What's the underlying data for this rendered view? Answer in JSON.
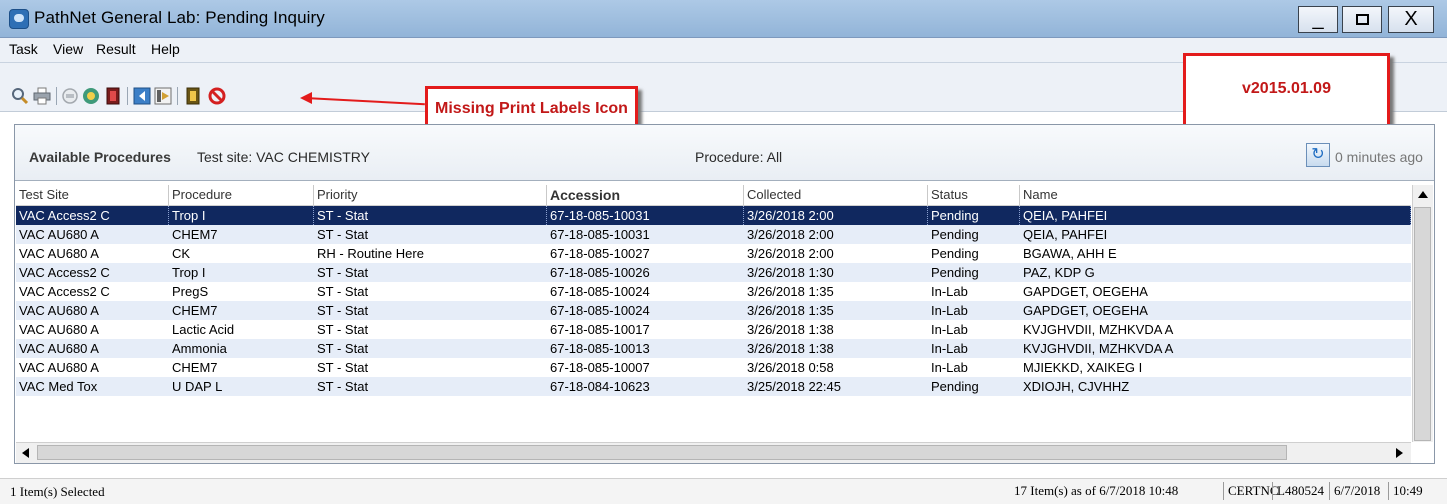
{
  "window": {
    "title": "PathNet General Lab: Pending Inquiry",
    "controls": {
      "minimize": "_",
      "close": "X"
    }
  },
  "menu": [
    "Task",
    "View",
    "Result",
    "Help"
  ],
  "toolbar": {
    "icons": [
      "magnifier-icon",
      "printer-icon",
      "disabled-icon",
      "query-icon",
      "red-book-icon",
      "blue-arrow-left-icon",
      "arrow-right-icon",
      "yellow-book-icon",
      "cancel-icon"
    ]
  },
  "annotations": {
    "missing_labels": "Missing Print Labels Icon",
    "version": "v2015.01.09"
  },
  "panel": {
    "available_label": "Available Procedures",
    "test_site": "Test site:  VAC CHEMISTRY",
    "procedure_filter": "Procedure:  All",
    "refresh_icon": "refresh-icon",
    "last_refreshed": "0 minutes ago"
  },
  "table": {
    "columns": [
      "Test Site",
      "Procedure",
      "Priority",
      "Accession",
      "Collected",
      "Status",
      "Name"
    ],
    "rows": [
      [
        "VAC Access2 C",
        "Trop I",
        "ST - Stat",
        "67-18-085-10031",
        "3/26/2018 2:00",
        "Pending",
        "QEIA, PAHFEI"
      ],
      [
        "VAC AU680 A",
        "CHEM7",
        "ST - Stat",
        "67-18-085-10031",
        "3/26/2018 2:00",
        "Pending",
        "QEIA, PAHFEI"
      ],
      [
        "VAC AU680 A",
        "CK",
        "RH - Routine Here",
        "67-18-085-10027",
        "3/26/2018 2:00",
        "Pending",
        "BGAWA, AHH E"
      ],
      [
        "VAC Access2 C",
        "Trop I",
        "ST - Stat",
        "67-18-085-10026",
        "3/26/2018 1:30",
        "Pending",
        "PAZ, KDP G"
      ],
      [
        "VAC Access2 C",
        "PregS",
        "ST - Stat",
        "67-18-085-10024",
        "3/26/2018 1:35",
        "In-Lab",
        "GAPDGET, OEGEHA"
      ],
      [
        "VAC AU680 A",
        "CHEM7",
        "ST - Stat",
        "67-18-085-10024",
        "3/26/2018 1:35",
        "In-Lab",
        "GAPDGET, OEGEHA"
      ],
      [
        "VAC AU680 A",
        "Lactic Acid",
        "ST - Stat",
        "67-18-085-10017",
        "3/26/2018 1:38",
        "In-Lab",
        "KVJGHVDII, MZHKVDA A"
      ],
      [
        "VAC AU680 A",
        "Ammonia",
        "ST - Stat",
        "67-18-085-10013",
        "3/26/2018 1:38",
        "In-Lab",
        "KVJGHVDII, MZHKVDA A"
      ],
      [
        "VAC AU680 A",
        "CHEM7",
        "ST - Stat",
        "67-18-085-10007",
        "3/26/2018 0:58",
        "In-Lab",
        "MJIEKKD, XAIKEG I"
      ],
      [
        "VAC Med Tox",
        "U DAP L",
        "ST - Stat",
        "67-18-084-10623",
        "3/25/2018 22:45",
        "Pending",
        "XDIOJH, CJVHHZ"
      ]
    ],
    "selected_row": 0
  },
  "status": {
    "selection": "1 Item(s) Selected",
    "items_as_of": "17 Item(s) as of 6/7/2018 10:48",
    "env": "CERTNC",
    "user": "L480524",
    "date": "6/7/2018",
    "time": "10:49"
  },
  "colors": {
    "selection": "#10285f",
    "alt_row": "#e6edf8",
    "callout": "#e31b1b"
  }
}
